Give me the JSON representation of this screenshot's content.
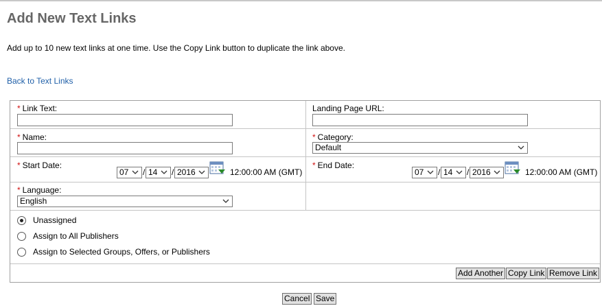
{
  "page": {
    "title": "Add New Text Links",
    "intro": "Add up to 10 new text links at one time. Use the Copy Link button to duplicate the link above.",
    "back_link": "Back to Text Links"
  },
  "form": {
    "required_mark": "*",
    "link_text": {
      "label": "Link Text:",
      "value": ""
    },
    "landing_page_url": {
      "label": "Landing Page URL:",
      "value": ""
    },
    "name": {
      "label": "Name:",
      "value": ""
    },
    "category": {
      "label": "Category:",
      "value": "Default"
    },
    "start_date": {
      "label": "Start Date:",
      "month": "07",
      "day": "14",
      "year": "2016",
      "time": "12:00:00 AM (GMT)"
    },
    "end_date": {
      "label": "End Date:",
      "month": "07",
      "day": "14",
      "year": "2016",
      "time": "12:00:00 AM (GMT)"
    },
    "date_separator": "/",
    "language": {
      "label": "Language:",
      "value": "English"
    },
    "assignment": {
      "selected": "Unassigned",
      "options": [
        "Unassigned",
        "Assign to All Publishers",
        "Assign to Selected Groups, Offers, or Publishers"
      ]
    },
    "buttons": {
      "add_another": "Add Another",
      "copy_link": "Copy Link",
      "remove_link": "Remove Link"
    }
  },
  "footer": {
    "cancel": "Cancel",
    "save": "Save"
  },
  "colors": {
    "title": "#666666",
    "link": "#1f5fa8",
    "required": "#d01010",
    "border": "#a0a0a0",
    "button_bg": "#e1e1e1"
  },
  "icons": {
    "calendar": "calendar-icon",
    "dropdown": "chevron-down-icon"
  }
}
